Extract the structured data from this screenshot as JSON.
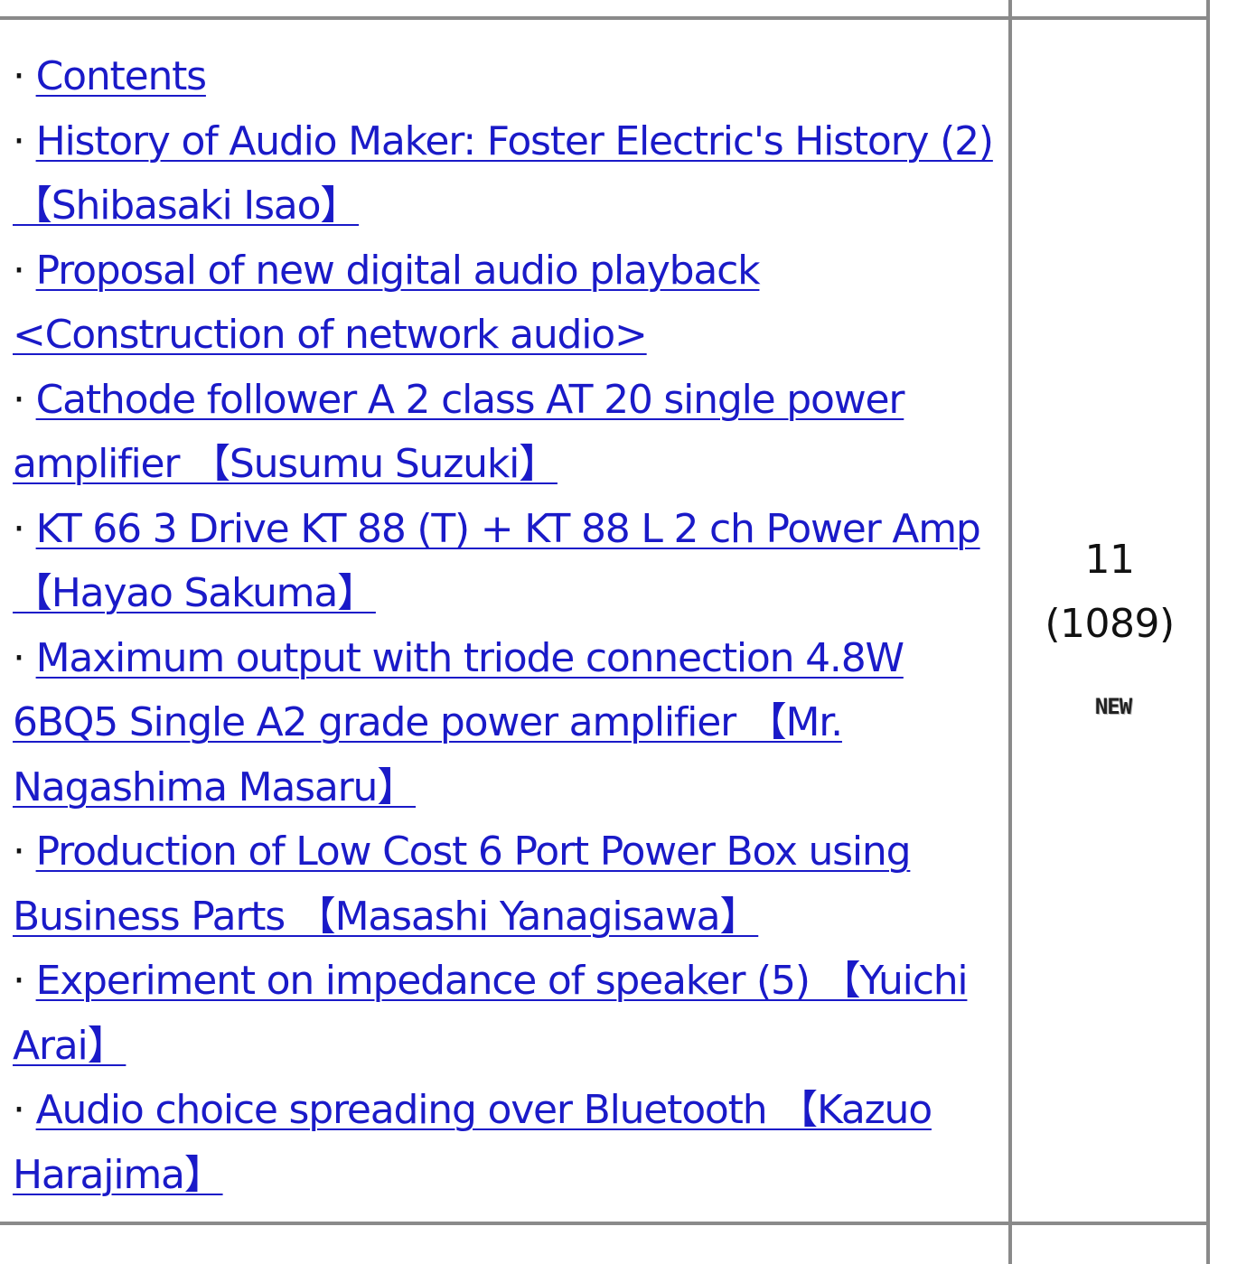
{
  "articles": [
    {
      "label": "Contents"
    },
    {
      "label": "History of Audio Maker: Foster Electric's History (2) 【Shibasaki Isao】"
    },
    {
      "label": "Proposal of new digital audio playback <Construction of network audio>"
    },
    {
      "label": "Cathode follower A 2 class AT 20 single power amplifier 【Susumu Suzuki】"
    },
    {
      "label": "KT 66 3 Drive KT 88 (T) + KT 88 L 2 ch Power Amp 【Hayao Sakuma】"
    },
    {
      "label": "Maximum output with triode connection 4.8W 6BQ5 Single A2 grade power amplifier 【Mr. Nagashima Masaru】"
    },
    {
      "label": "Production of Low Cost 6 Port Power Box using Business Parts 【Masashi Yanagisawa】"
    },
    {
      "label": "Experiment on impedance of speaker (5) 【Yuichi Arai】"
    },
    {
      "label": "Audio choice spreading over Bluetooth 【Kazuo Harajima】"
    }
  ],
  "bullet": "·",
  "issue": {
    "number": "11",
    "total": "(1089)",
    "badge": "NEW"
  },
  "colors": {
    "link": "#1a1ac8",
    "border": "#8a8a8a"
  }
}
